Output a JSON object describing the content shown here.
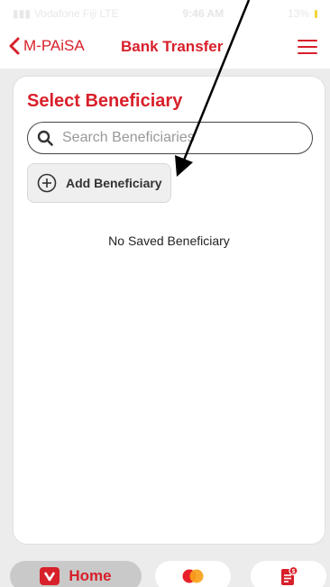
{
  "status_bar": {
    "carrier": "Vodafone Fiji LTE",
    "time": "9:46 AM",
    "battery": "13%"
  },
  "nav": {
    "back_label": "M-PAiSA",
    "title": "Bank Transfer",
    "back_icon": "chevron-left-icon",
    "menu_icon": "hamburger-menu-icon"
  },
  "beneficiary": {
    "title": "Select Beneficiary",
    "search_placeholder": "Search Beneficiaries",
    "add_button_label": "Add Beneficiary",
    "empty_message": "No Saved Beneficiary"
  },
  "tabs": {
    "home_label": "Home",
    "card_icon": "mastercard-icon",
    "receipt_icon": "receipt-icon"
  },
  "colors": {
    "brand_red": "#d8202a"
  }
}
